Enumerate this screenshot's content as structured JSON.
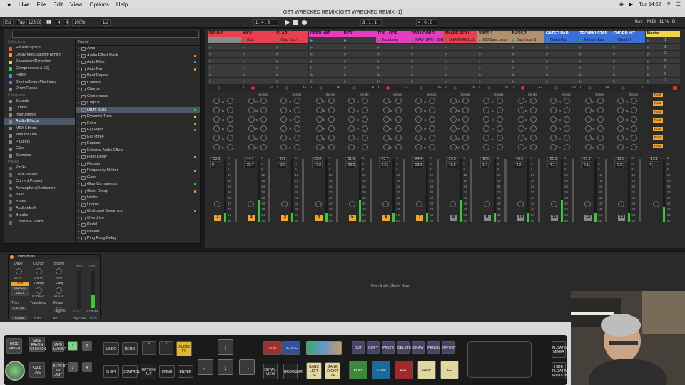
{
  "menubar": {
    "apple": "",
    "items": [
      "Live",
      "File",
      "Edit",
      "View",
      "Options",
      "Help"
    ],
    "clock": "Tue 14:52"
  },
  "window": {
    "title": "GET WRECKED REMIX  [GET WRECKED REMIX -1]"
  },
  "transport": {
    "ext": "Ext",
    "tap": "Tap",
    "tempo": "123.00",
    "sig_num": "4",
    "sig_den": "4",
    "zoom": "100%",
    "quant": "1/2",
    "pos": "1 . 4 . 3",
    "loop_start": "3 . 1 . 1",
    "loop_len": "4 . 0 . 0",
    "key": "Key",
    "midi": "MIDI",
    "cpu": "11 %",
    "d": "D"
  },
  "browser": {
    "collections_label": "Collections",
    "collections": [
      {
        "label": "Reverb/Space",
        "color": "#e55"
      },
      {
        "label": "Delay/Modulation/Panning",
        "color": "#e93"
      },
      {
        "label": "Saturation/Distortion",
        "color": "#ed3"
      },
      {
        "label": "Compression & EQ",
        "color": "#3c5"
      },
      {
        "label": "Filters",
        "color": "#39e"
      },
      {
        "label": "Synths/Drum Machines",
        "color": "#a5d"
      },
      {
        "label": "Drum Racks",
        "color": "#888"
      }
    ],
    "categories_label": "Categories",
    "categories": [
      {
        "label": "Sounds"
      },
      {
        "label": "Drums"
      },
      {
        "label": "Instruments"
      },
      {
        "label": "Audio Effects",
        "selected": true
      },
      {
        "label": "MIDI Effects"
      },
      {
        "label": "Max for Live"
      },
      {
        "label": "Plug-ins"
      },
      {
        "label": "Clips"
      },
      {
        "label": "Samples"
      }
    ],
    "places_label": "Places",
    "places": [
      {
        "label": "Packs"
      },
      {
        "label": "User Library"
      },
      {
        "label": "Current Project"
      },
      {
        "label": "Atmosphere/Ambience"
      },
      {
        "label": "Bass"
      },
      {
        "label": "Brass"
      },
      {
        "label": "Audiotekník"
      },
      {
        "label": "Breaks"
      },
      {
        "label": "Chords & Stabs"
      }
    ],
    "name_header": "Name",
    "items": [
      {
        "label": "Amp",
        "dot": ""
      },
      {
        "label": "Audio Effect Rack",
        "dot": "#e93"
      },
      {
        "label": "Auto Filter",
        "dot": "#39e"
      },
      {
        "label": "Auto Pan",
        "dot": "#e93"
      },
      {
        "label": "Beat Repeat",
        "dot": ""
      },
      {
        "label": "Cabinet",
        "dot": ""
      },
      {
        "label": "Chorus",
        "dot": ""
      },
      {
        "label": "Compressor",
        "dot": ""
      },
      {
        "label": "Corpus",
        "dot": ""
      },
      {
        "label": "Drum Buss",
        "dot": "#3c5",
        "selected": true
      },
      {
        "label": "Dynamic Tube",
        "dot": "#ed3"
      },
      {
        "label": "Echo",
        "dot": "#e93"
      },
      {
        "label": "EQ Eight",
        "dot": "#3c5"
      },
      {
        "label": "EQ Three",
        "dot": ""
      },
      {
        "label": "Erosion",
        "dot": ""
      },
      {
        "label": "External Audio Effect",
        "dot": ""
      },
      {
        "label": "Filter Delay",
        "dot": "#e93"
      },
      {
        "label": "Flanger",
        "dot": ""
      },
      {
        "label": "Frequency Shifter",
        "dot": "#e93"
      },
      {
        "label": "Gate",
        "dot": ""
      },
      {
        "label": "Glue Compressor",
        "dot": "#3c5"
      },
      {
        "label": "Grain Delay",
        "dot": "#e93"
      },
      {
        "label": "Limiter",
        "dot": ""
      },
      {
        "label": "Looper",
        "dot": ""
      },
      {
        "label": "Multiband Dynamics",
        "dot": "#3c5"
      },
      {
        "label": "Overdrive",
        "dot": ""
      },
      {
        "label": "Pedal",
        "dot": ""
      },
      {
        "label": "Phaser",
        "dot": ""
      },
      {
        "label": "Ping Pong Delay",
        "dot": ""
      }
    ]
  },
  "session": {
    "tracks": [
      {
        "name": "DRUMS",
        "color": "#e8404e",
        "clip": "",
        "clipcolor": "#e8404e",
        "num": "1",
        "numcolor": "#f3a42a",
        "vol": "-13.0",
        "vol2": "0",
        "sends": "",
        "right": ""
      },
      {
        "name": "KICK",
        "color": "#e8404e",
        "clip": "Kick",
        "clipcolor": "#e8404e",
        "num": "2",
        "numcolor": "#f3a42a",
        "vol": "-14.7",
        "vol2": "-30.7",
        "sends": "Sends",
        "right": "32"
      },
      {
        "name": "CLAP",
        "color": "#e8404e",
        "clip": "Clap Topo",
        "clipcolor": "#e8404e",
        "num": "3",
        "numcolor": "#f3a42a",
        "vol": "-6.1",
        "vol2": "-3.9",
        "sends": "Sends",
        "right": "16"
      },
      {
        "name": "OPEN HAT",
        "color": "#e43dc0",
        "clip": "",
        "clipcolor": "#e43dc0",
        "num": "4",
        "numcolor": "#f3a42a",
        "vol": "-22.8",
        "vol2": "-17.0",
        "sends": "Sends",
        "right": "16"
      },
      {
        "name": "RIDE",
        "color": "#e43dc0",
        "clip": "",
        "clipcolor": "#e43dc0",
        "num": "5",
        "numcolor": "#f3a42a",
        "vol": "-31.6",
        "vol2": "-28.2",
        "sends": "Sends",
        "right": "4"
      },
      {
        "name": "TOP LOOP",
        "color": "#e43dc0",
        "clip": "Tops Loop",
        "clipcolor": "#e43dc0",
        "num": "6",
        "numcolor": "#f3a42a",
        "vol": "-23.7",
        "vol2": "-5.5",
        "sends": "Sends",
        "right": "32"
      },
      {
        "name": "TOP LOOP 2",
        "color": "#e43dc0",
        "clip": "RAW_BRTH_DIG",
        "clipcolor": "#e43dc0",
        "num": "7",
        "numcolor": "#f3a42a",
        "vol": "-24.4",
        "vol2": "-23.3",
        "sends": "Sends",
        "right": "16"
      },
      {
        "name": "SNARE ROLL",
        "color": "#e8404e",
        "clip": "SNARE ROLL 1",
        "clipcolor": "#e8404e",
        "num": "8",
        "numcolor": "#888888",
        "vol": "-20.3",
        "vol2": "-15.6",
        "sends": "Sends",
        "right": "16"
      },
      {
        "name": "BASS 1",
        "color": "#b09070",
        "clip": "808 Bass Loop",
        "clipcolor": "#b09070",
        "num": "9",
        "numcolor": "#888888",
        "vol": "-16.8",
        "vol2": "-1.7",
        "sends": "Sends",
        "right": "32"
      },
      {
        "name": "BASS 2",
        "color": "#b09070",
        "clip": "Bass Loop 1",
        "clipcolor": "#b09070",
        "num": "10",
        "numcolor": "#888888",
        "vol": "-16.5",
        "vol2": "-2.2",
        "sends": "Sends",
        "right": "32"
      },
      {
        "name": "GATED PAD",
        "color": "#3a6ed8",
        "clip": "Gated Pad Sweep",
        "clipcolor": "#3a6ed8",
        "num": "11",
        "numcolor": "#888888",
        "vol": "-21.3",
        "vol2": "-4.1",
        "sends": "Sends",
        "right": "16"
      },
      {
        "name": "TECHNO STAB",
        "color": "#3a6ed8",
        "clip": "Techno Stab",
        "clipcolor": "#3a6ed8",
        "num": "12",
        "numcolor": "#888888",
        "vol": "-21.3",
        "vol2": "-0.1",
        "sends": "Sends",
        "right": "64"
      },
      {
        "name": "CHORD HIT",
        "color": "#3a6ed8",
        "clip": "Chord Hi",
        "clipcolor": "#3a6ed8",
        "num": "13",
        "numcolor": "#888888",
        "vol": "-19.6",
        "vol2": "-2.8",
        "sends": "Sends",
        "right": "1"
      }
    ],
    "master": {
      "name": "Master",
      "color": "#f2d64b",
      "scenes": [
        "1",
        "2",
        "3",
        "4",
        "5",
        "6",
        "7"
      ],
      "vol": "-13.1",
      "vol2": "0",
      "post": "Post"
    },
    "send_letters": [
      "A",
      "B",
      "C",
      "D",
      "E",
      "F",
      "G",
      "H",
      "I",
      "J"
    ],
    "scale": [
      "6",
      "0",
      "6",
      "12",
      "18",
      "24",
      "30",
      "36",
      "42",
      "48",
      "54",
      "60"
    ]
  },
  "device": {
    "name": "Drum Buss",
    "drive_label": "Drive",
    "drive_val": "20 %",
    "crunch_label": "Crunch",
    "crunch_val": "0.0 %",
    "boom_label": "Boom",
    "boom_val": "16 %",
    "soft": "Soft",
    "medium": "Medium",
    "hard": "Hard",
    "damp_label": "Damp",
    "damp_val": "9.20 kHz",
    "freq_label": "Freq",
    "freq_val": "50.0 Hz",
    "trim_label": "Trim",
    "trim_val": "0.00 dB",
    "transients_label": "Transients",
    "decay_label": "Decay",
    "decay_val": "100 %",
    "comp": "Comp",
    "trans_val": "0.00",
    "boost": "Bst",
    "bass_label": "Bass",
    "out_label": "Out",
    "meter1": "16.5",
    "meter2": "-4.03 dB",
    "drywet": "Dry / Wet",
    "drywet_val": "50 %",
    "drop_text": "Drop Audio Effects Here"
  },
  "controller": {
    "hide_raven": "HIDE RAVEN",
    "save_raven_session": "SAVE RAVEN SESSION",
    "save_layout": "SAVE LAYOUT",
    "b1": "1",
    "b2": "2",
    "b3": "3",
    "b4": "4",
    "save_live": "SAVE LIVE",
    "revert_to_last": "REVERT TO LAST",
    "undo": "UNDO",
    "redo": "REDO",
    "audio_fx": "AUDIO FX",
    "shift": "SHIFT",
    "control": "CONTROL",
    "option_alt": "OPTION ALT",
    "cmnd": "CMND",
    "enter": "ENTER",
    "clip": "CLIP",
    "device": "DEVICE",
    "detail_view": "DETAIL VIEW",
    "browser": "BROWSER",
    "bank_left": "BANK LEFT 24",
    "bank_right": "BANK RIGHT 24",
    "cut": "CUT",
    "copy": "COPY",
    "paste": "PASTE",
    "delete": "DELETE",
    "draw": "DRAW",
    "pencil": "PENCIL",
    "import": "IMPORT",
    "play": "PLAY",
    "stop": "STOP",
    "rec": "REC",
    "rew": "REW",
    "ff": "FF",
    "floating_mixer": "FLOATING MIXER",
    "hide_floating_window": "HIDE FLOATING WINDOW"
  }
}
